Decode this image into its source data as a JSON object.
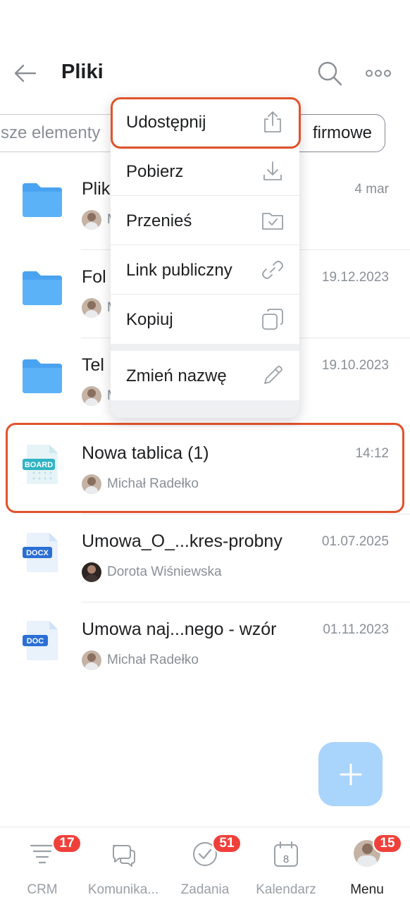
{
  "header": {
    "title": "Pliki"
  },
  "filters": {
    "left_label": "sze elementy",
    "right_label": "firmowe"
  },
  "files": [
    {
      "name": "Plik",
      "date": "4 mar",
      "author": "M",
      "type": "folder"
    },
    {
      "name": "Fol",
      "date": "19.12.2023",
      "author": "M",
      "type": "folder"
    },
    {
      "name": "Tel",
      "date": "19.10.2023",
      "author": "M",
      "type": "folder"
    },
    {
      "name": "Nowa tablica (1)",
      "date": "14:12",
      "author": "Michał Radełko",
      "type": "board",
      "badge": "BOARD"
    },
    {
      "name": "Umowa_O_...kres-probny",
      "date": "01.07.2025",
      "author": "Dorota Wiśniewska",
      "type": "docx",
      "badge": "DOCX"
    },
    {
      "name": "Umowa naj...nego - wzór",
      "date": "01.11.2023",
      "author": "Michał Radełko",
      "type": "doc",
      "badge": "DOC"
    }
  ],
  "context_menu": {
    "items": [
      {
        "label": "Udostępnij",
        "icon": "share-icon"
      },
      {
        "label": "Pobierz",
        "icon": "download-icon"
      },
      {
        "label": "Przenieś",
        "icon": "move-folder-icon"
      },
      {
        "label": "Link publiczny",
        "icon": "link-icon"
      },
      {
        "label": "Kopiuj",
        "icon": "copy-icon"
      },
      {
        "label": "Zmień nazwę",
        "icon": "pencil-icon"
      }
    ]
  },
  "tabbar": {
    "tabs": [
      {
        "label": "CRM",
        "badge": "17",
        "icon": "crm-filter-icon"
      },
      {
        "label": "Komunika...",
        "badge": "",
        "icon": "chat-icon"
      },
      {
        "label": "Zadania",
        "badge": "51",
        "icon": "check-circle-icon"
      },
      {
        "label": "Kalendarz",
        "badge": "",
        "icon": "calendar-icon",
        "day": "8"
      },
      {
        "label": "Menu",
        "badge": "15",
        "icon": "avatar"
      }
    ]
  },
  "colors": {
    "accent": "#e0532b",
    "badge": "#f0403a",
    "folder": "#4aa3f0",
    "fab": "#a9d4fb"
  }
}
